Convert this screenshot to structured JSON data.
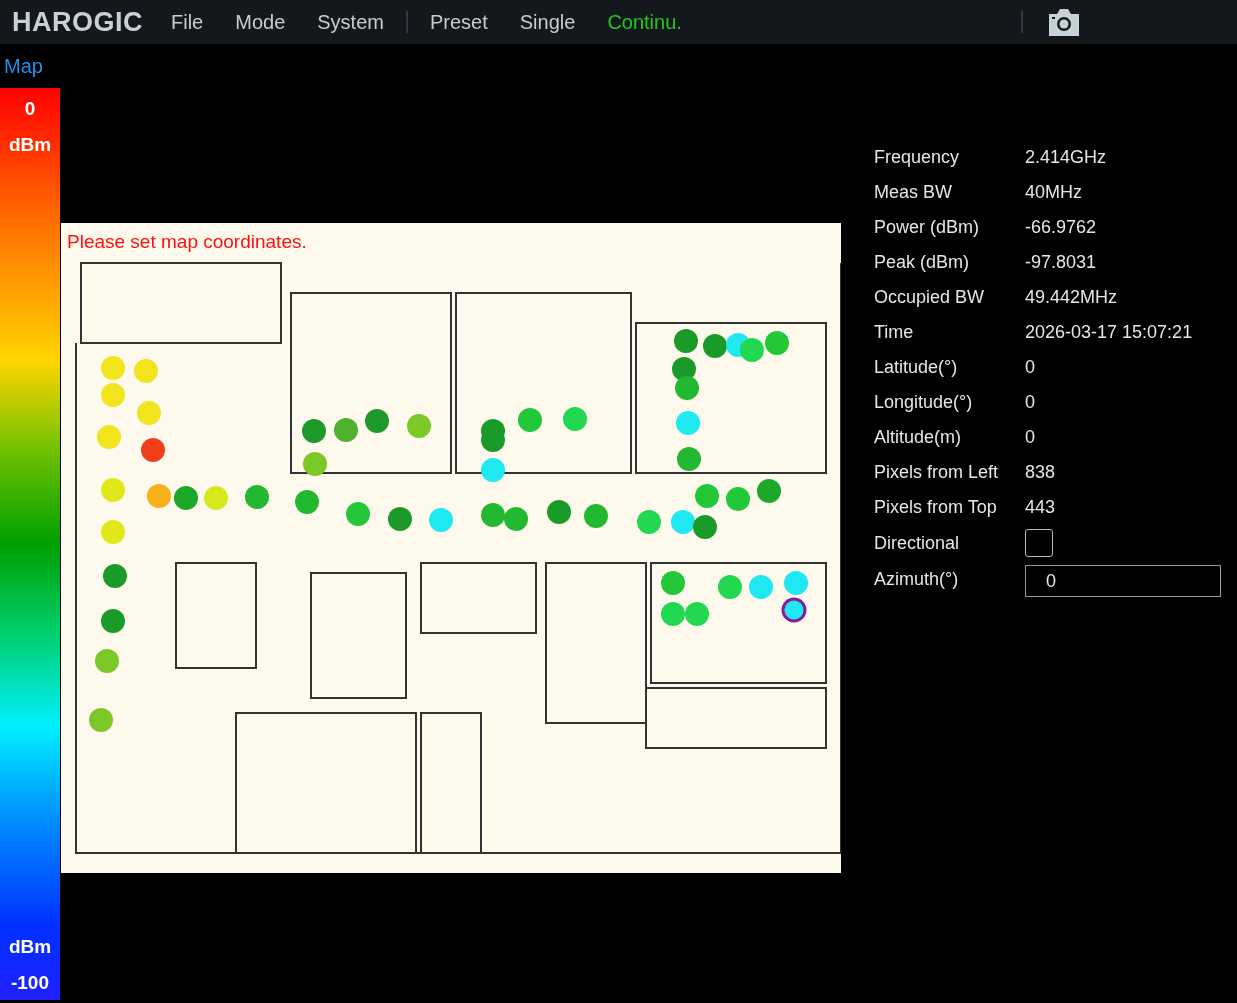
{
  "app": {
    "logo": "HAROGIC"
  },
  "menu": [
    {
      "label": "File",
      "selected": false
    },
    {
      "label": "Mode",
      "selected": false
    },
    {
      "label": "System",
      "selected": false
    },
    {
      "label": "Preset",
      "selected": false,
      "divider_before": true
    },
    {
      "label": "Single",
      "selected": false
    },
    {
      "label": "Continu.",
      "selected": true
    }
  ],
  "tab": {
    "label": "Map"
  },
  "scale": {
    "top_value": "0",
    "top_unit": "dBm",
    "bottom_unit": "dBm",
    "bottom_value": "-100"
  },
  "map": {
    "warning": "Please set map coordinates."
  },
  "readings": [
    {
      "label": "Frequency",
      "value": "2.414GHz"
    },
    {
      "label": "Meas BW",
      "value": "40MHz"
    },
    {
      "label": "Power (dBm)",
      "value": "-66.9762"
    },
    {
      "label": "Peak (dBm)",
      "value": "-97.8031"
    },
    {
      "label": "Occupied BW",
      "value": "49.442MHz"
    },
    {
      "label": "Time",
      "value": "2026-03-17 15:07:21"
    },
    {
      "label": "Latitude(°)",
      "value": "0"
    },
    {
      "label": "Longitude(°)",
      "value": "0"
    },
    {
      "label": "Altitude(m)",
      "value": "0"
    },
    {
      "label": "Pixels from Left",
      "value": "838"
    },
    {
      "label": "Pixels from Top",
      "value": "443"
    }
  ],
  "directional": {
    "label": "Directional",
    "checked": false
  },
  "azimuth": {
    "label": "Azimuth(°)",
    "value": "0"
  }
}
